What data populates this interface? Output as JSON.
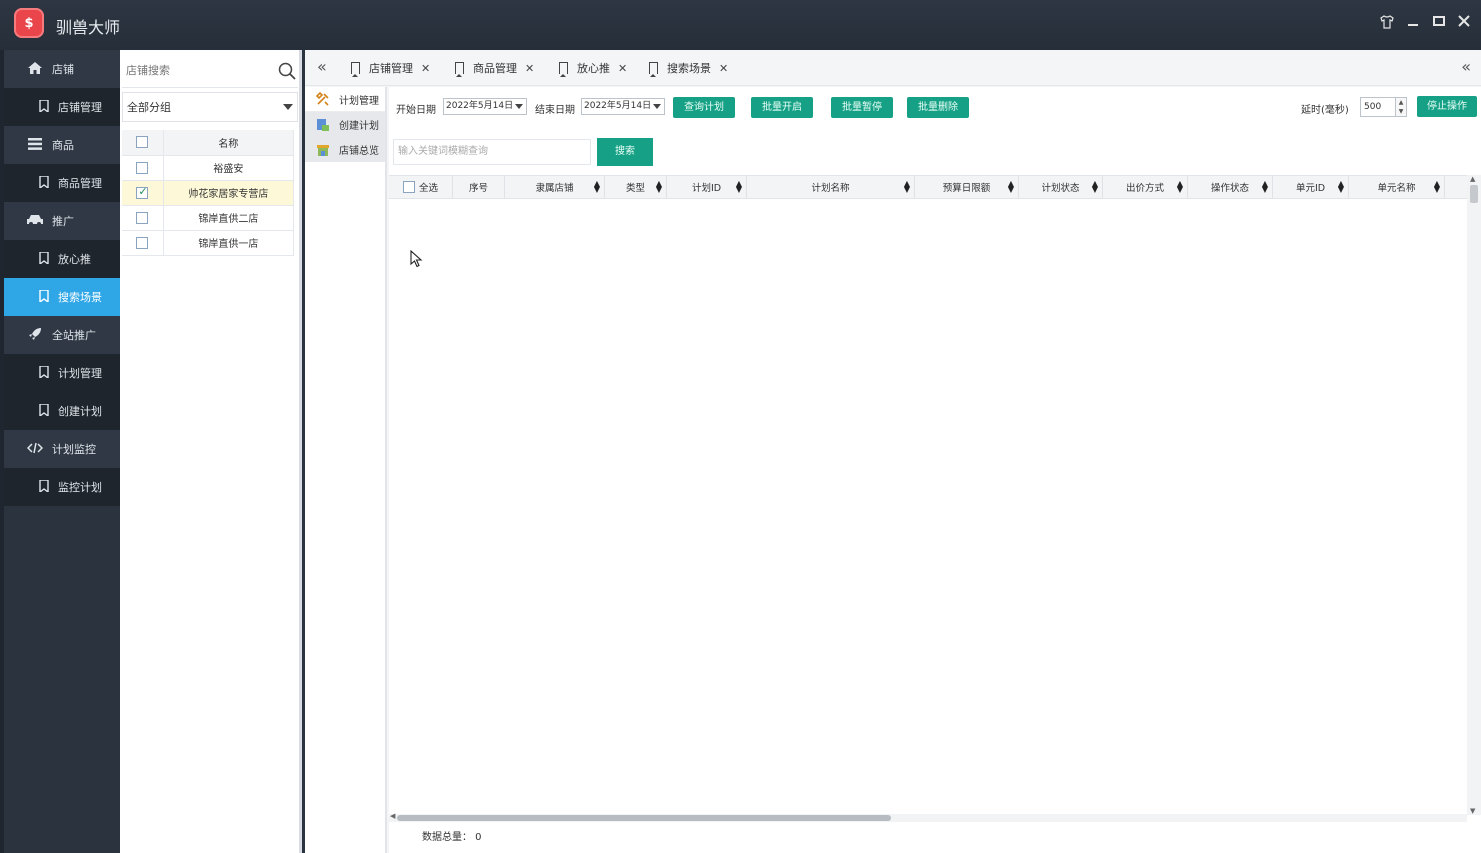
{
  "app": {
    "title": "驯兽大师",
    "logo_text": "$"
  },
  "window_controls": [
    "shirt-icon",
    "minimize-icon",
    "maximize-icon",
    "close-icon"
  ],
  "nav": {
    "items": [
      {
        "label": "店铺",
        "type": "category",
        "icon": "home-icon"
      },
      {
        "label": "店铺管理",
        "type": "sub",
        "icon": "bookmark-icon"
      },
      {
        "label": "商品",
        "type": "category",
        "icon": "list-icon"
      },
      {
        "label": "商品管理",
        "type": "sub",
        "icon": "bookmark-icon"
      },
      {
        "label": "推广",
        "type": "category",
        "icon": "car-icon"
      },
      {
        "label": "放心推",
        "type": "sub",
        "icon": "bookmark-icon"
      },
      {
        "label": "搜索场景",
        "type": "sub",
        "icon": "bookmark-icon",
        "active": true
      },
      {
        "label": "全站推广",
        "type": "category",
        "icon": "rocket-icon"
      },
      {
        "label": "计划管理",
        "type": "sub",
        "icon": "bookmark-icon"
      },
      {
        "label": "创建计划",
        "type": "sub",
        "icon": "bookmark-icon"
      },
      {
        "label": "计划监控",
        "type": "category",
        "icon": "code-icon"
      },
      {
        "label": "监控计划",
        "type": "sub",
        "icon": "bookmark-icon"
      }
    ]
  },
  "shop_panel": {
    "search_placeholder": "店铺搜索",
    "group_select": "全部分组",
    "table_header": "名称",
    "rows": [
      {
        "name": "裕盛安",
        "checked": false
      },
      {
        "name": "帅花家居家专营店",
        "checked": true
      },
      {
        "name": "锦岸直供二店",
        "checked": false
      },
      {
        "name": "锦岸直供一店",
        "checked": false
      }
    ]
  },
  "tabs": [
    {
      "label": "店铺管理"
    },
    {
      "label": "商品管理"
    },
    {
      "label": "放心推"
    },
    {
      "label": "搜索场景"
    }
  ],
  "subnav": [
    {
      "label": "计划管理",
      "icon": "tools-icon"
    },
    {
      "label": "创建计划",
      "icon": "create-icon"
    },
    {
      "label": "店铺总览",
      "icon": "store-icon"
    }
  ],
  "toolbar": {
    "start_label": "开始日期",
    "start_value": "2022年5月14日",
    "end_label": "结束日期",
    "end_value": "2022年5月14日",
    "query_btn": "查询计划",
    "batch_open_btn": "批量开启",
    "batch_pause_btn": "批量暂停",
    "batch_delete_btn": "批量删除",
    "delay_label": "延时(毫秒)",
    "delay_value": "500",
    "stop_btn": "停止操作"
  },
  "search": {
    "placeholder": "输入关键词模糊查询",
    "button": "搜索"
  },
  "grid": {
    "select_all": "全选",
    "columns": [
      "序号",
      "隶属店铺",
      "类型",
      "计划ID",
      "计划名称",
      "预算日限额",
      "计划状态",
      "出价方式",
      "操作状态",
      "单元ID",
      "单元名称"
    ]
  },
  "footer": {
    "total_text": "数据总量： 0"
  }
}
